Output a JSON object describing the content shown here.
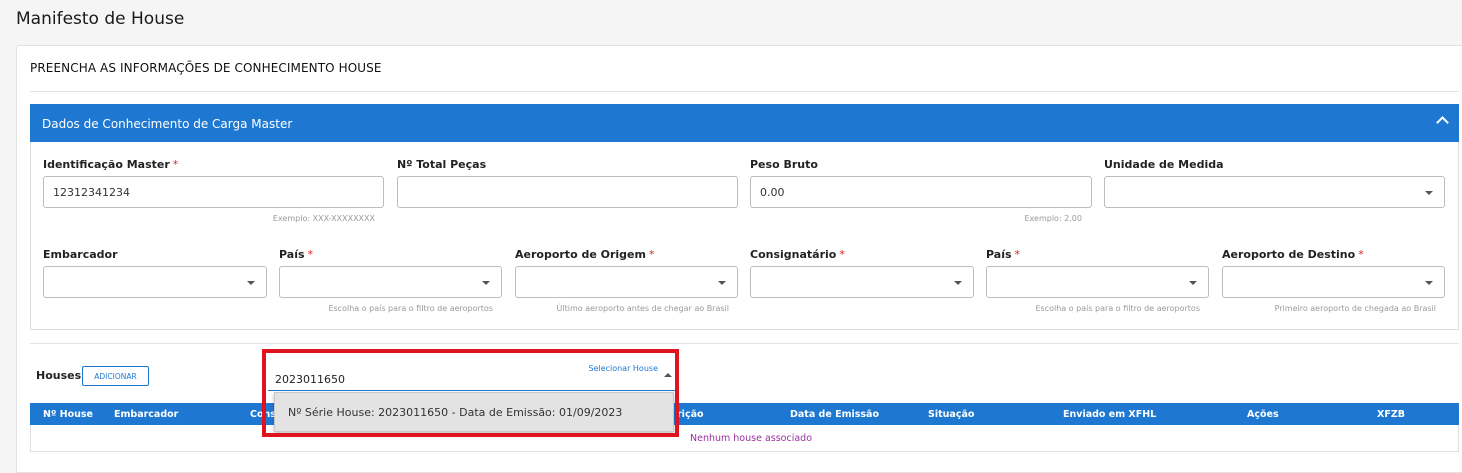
{
  "page": {
    "title": "Manifesto de House"
  },
  "card": {
    "title": "PREENCHA AS INFORMAÇÕES DE CONHECIMENTO HOUSE"
  },
  "panel": {
    "title": "Dados de Conhecimento de Carga Master",
    "collapse_icon": "chevron-up-icon"
  },
  "fields": {
    "master_id": {
      "label": "Identificação Master",
      "required": "*",
      "value": "12312341234",
      "hint": "Exemplo: XXX-XXXXXXXX"
    },
    "total_pecas": {
      "label": "Nº Total Peças",
      "value": ""
    },
    "peso_bruto": {
      "label": "Peso Bruto",
      "value": "0.00",
      "hint": "Exemplo: 2.00"
    },
    "unidade_medida": {
      "label": "Unidade de Medida",
      "value": ""
    },
    "embarcador": {
      "label": "Embarcador",
      "value": ""
    },
    "pais_origem": {
      "label": "País",
      "required": "*",
      "value": "",
      "hint": "Escolha o país para o filtro de aeroportos"
    },
    "aeroporto_origem": {
      "label": "Aeroporto de Origem",
      "required": "*",
      "value": "",
      "hint": "Último aeroporto antes de chegar ao Brasil"
    },
    "consignatario": {
      "label": "Consignatário",
      "required": "*",
      "value": ""
    },
    "pais_destino": {
      "label": "País",
      "required": "*",
      "value": "",
      "hint": "Escolha o país para o filtro de aeroportos"
    },
    "aeroporto_destino": {
      "label": "Aeroporto de Destino",
      "required": "*",
      "value": "",
      "hint": "Primeiro aeroporto de chegada ao Brasil"
    }
  },
  "houses": {
    "label": "Houses",
    "add_button": "ADICIONAR",
    "select_label": "Selecionar House",
    "select_value": "2023011650",
    "dropdown_option": "Nº Série House: 2023011650 - Data de Emissão: 01/09/2023",
    "columns": {
      "n_house": "Nº House",
      "embarcador": "Embarcador",
      "consignatario": "Consi",
      "descricao": "rição",
      "data_emissao": "Data de Emissão",
      "situacao": "Situação",
      "enviado_xfhl": "Enviado em XFHL",
      "acoes": "Ações",
      "xfzb": "XFZB"
    },
    "empty_text": "Nenhum house associado"
  },
  "colors": {
    "primary": "#1e78d2",
    "highlight": "#e0141e",
    "empty_text": "#9b2fa0",
    "required": "#e02020"
  }
}
